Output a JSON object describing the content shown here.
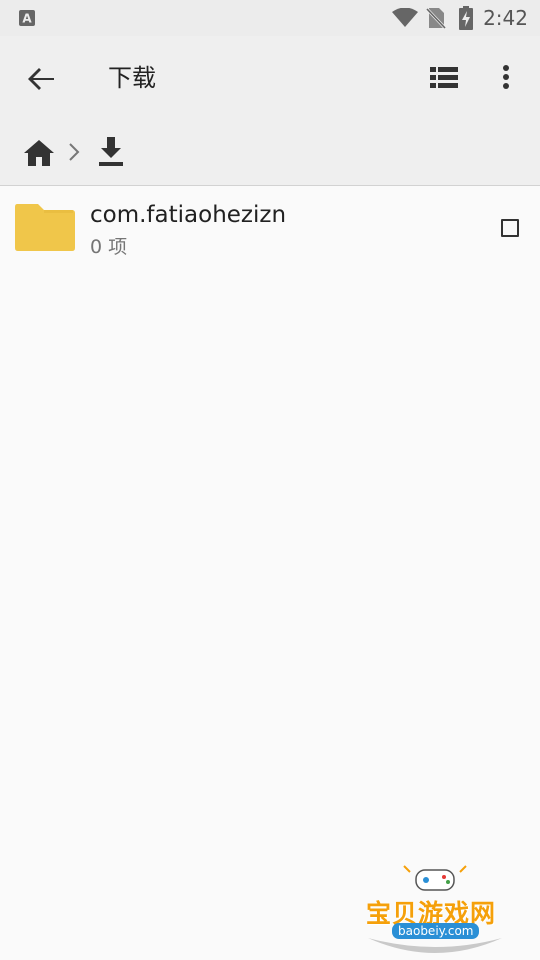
{
  "status_bar": {
    "time": "2:42"
  },
  "toolbar": {
    "title": "下载"
  },
  "breadcrumb": {
    "items": [
      "home",
      "download"
    ]
  },
  "files": [
    {
      "name": "com.fatiaohezizn",
      "meta": "0 项",
      "checked": false
    }
  ],
  "watermark": {
    "title": "宝贝游戏网",
    "url": "baobeiy.com"
  },
  "colors": {
    "folder": "#f0c64a",
    "toolbar_bg": "#efefef",
    "status_bg": "#ececec",
    "watermark": "#f5a00a"
  }
}
